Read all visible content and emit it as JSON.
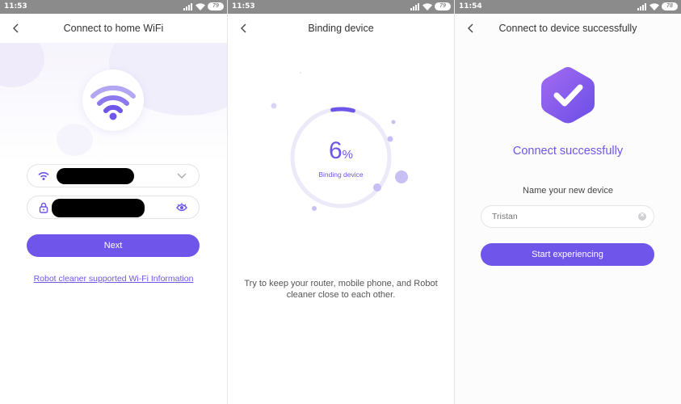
{
  "screens": [
    {
      "status": {
        "time": "11:53",
        "battery": "79"
      },
      "title": "Connect to home WiFi",
      "wifi_field": {
        "icon": "wifi-icon",
        "dropdown_icon": "chevron-down-icon"
      },
      "password_field": {
        "icon": "lock-icon",
        "toggle_icon": "eye-icon"
      },
      "next_label": "Next",
      "link_text": "Robot cleaner supported Wi-Fi Information"
    },
    {
      "status": {
        "time": "11:53",
        "battery": "79"
      },
      "title": "Binding device",
      "progress": {
        "value": "6",
        "unit": "%",
        "fraction": 0.06
      },
      "progress_label": "Binding device",
      "hint": "Try to keep your router, mobile phone, and Robot cleaner close to each other."
    },
    {
      "status": {
        "time": "11:54",
        "battery": "78"
      },
      "title": "Connect to device successfully",
      "success_title": "Connect successfully",
      "name_label": "Name your new device",
      "name_placeholder": "Tristan",
      "start_label": "Start experiencing"
    }
  ],
  "colors": {
    "accent": "#6f55e9",
    "accent_light": "#a393f0",
    "statusbar": "#8b8b8b"
  }
}
